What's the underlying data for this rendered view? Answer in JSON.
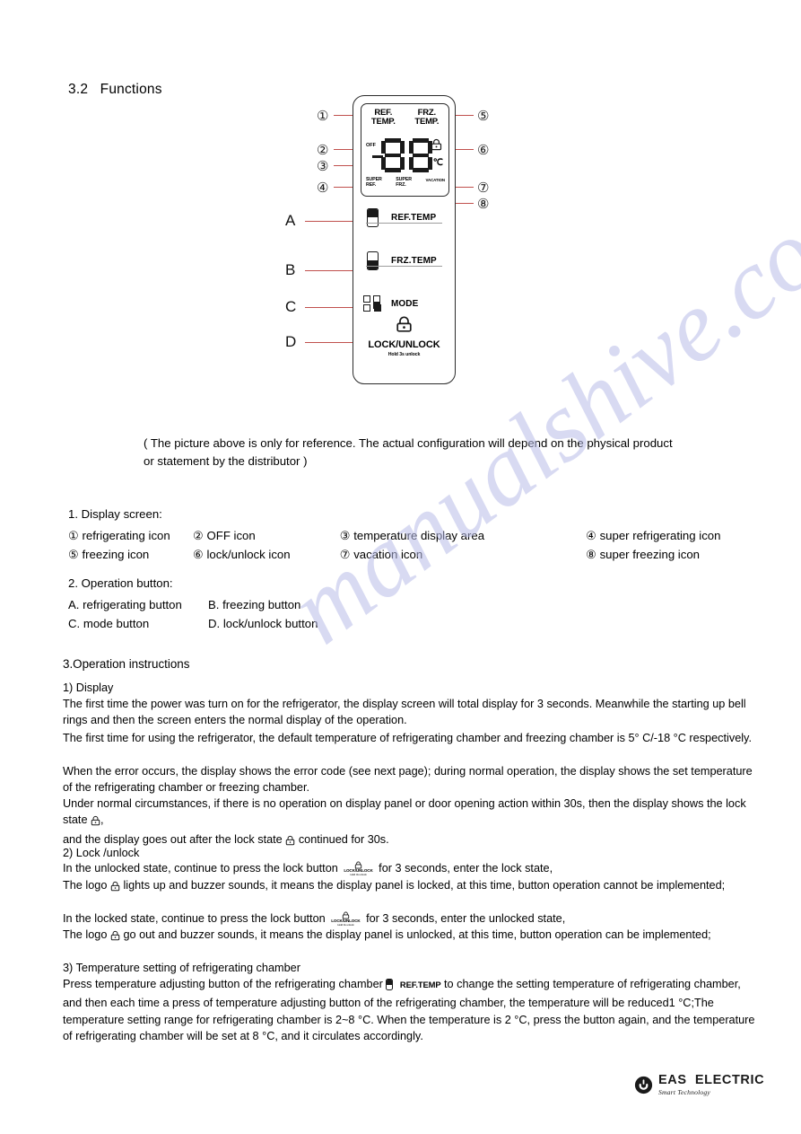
{
  "heading": "3.2   Functions",
  "panel": {
    "lcd": {
      "ref_temp_label": "REF.\nTEMP.",
      "frz_temp_label": "FRZ.\nTEMP.",
      "off_label": "OFF",
      "digits": "88",
      "unit_label": "℃",
      "super_ref_label": "SUPER\nREF.",
      "super_frz_label": "SUPER\nFRZ.",
      "vacation_label": "VACATION"
    },
    "buttons": [
      {
        "label": "REF.TEMP",
        "icon": "switch-top-dark-icon"
      },
      {
        "label": "FRZ.TEMP",
        "icon": "switch-bottom-dark-icon"
      },
      {
        "label": "MODE",
        "icon": "mode-grid-icon"
      }
    ],
    "lock": {
      "title": "LOCK/UNLOCK",
      "subtitle": "Hold 3s unlock",
      "icon": "padlock-icon"
    }
  },
  "callouts": {
    "left_numbers": [
      "①",
      "②",
      "③",
      "④"
    ],
    "right_numbers": [
      "⑤",
      "⑥",
      "⑦",
      "⑧"
    ],
    "letters": [
      "A",
      "B",
      "C",
      "D"
    ]
  },
  "reference_note": "( The picture above is only for reference. The actual configuration will depend on the physical product or statement by the distributor )",
  "display_screen": {
    "heading": "1. Display screen:",
    "items": [
      "① refrigerating icon",
      "② OFF icon",
      "③ temperature display area",
      "④ super refrigerating icon",
      "⑤ freezing icon",
      "⑥ lock/unlock icon",
      "⑦ vacation icon",
      "⑧ super freezing icon"
    ]
  },
  "operation_button": {
    "heading": "2. Operation button:",
    "items": [
      "A. refrigerating button",
      "B. freezing button",
      "C. mode button",
      "D. lock/unlock button"
    ]
  },
  "instructions": {
    "heading": "3.Operation instructions",
    "display_heading": "1) Display",
    "p1": "The first time the power was turn on for the refrigerator, the display screen will total display  for  3 seconds. Meanwhile the starting up bell rings and then the screen enters the normal display of the operation.",
    "p2": "The first time for using the refrigerator, the default temperature of refrigerating chamber and freezing chamber is 5° C/-18 °C respectively.",
    "p3": "When the error occurs, the display shows the error code (see next page); during normal operation, the display shows the set temperature of the  refrigerating chamber or freezing chamber.",
    "p4_a": "Under normal circumstances, if there is no operation on display panel or door opening action within 30s, then the display shows the lock state",
    "p4_b": ",",
    "p4_c": "and the display goes out after the lock state",
    "p4_d": "continued for 30s.",
    "lock_heading": "2) Lock /unlock",
    "p5_a": "In the unlocked state, continue to press the lock button",
    "p5_b": "for 3 seconds, enter the lock state,",
    "p6_a": "The logo",
    "p6_b": "lights up  and buzzer sounds, it means the display panel is locked, at this time, button operation cannot be implemented;",
    "p7_a": "In the locked state, continue to press the lock button",
    "p7_b": "for 3 seconds, enter the unlocked state,",
    "p8_a": "The logo",
    "p8_b": "go out and buzzer sounds, it means the display panel is unlocked, at this time, button operation can be implemented;",
    "temp_heading": "3) Temperature setting of refrigerating chamber",
    "p9_a": "Press temperature adjusting button of the refrigerating chamber",
    "p9_btn_label": "REF.TEMP",
    "p9_b": "to change the setting temperature of refrigerating chamber, and then each time a press of temperature adjusting button of the refrigerating chamber, the temperature will be reduced1 °C;The temperature setting range for refrigerating chamber is 2~8 °C. When the temperature is 2 °C, press the button again, and the temperature of refrigerating chamber will be set at 8 °C, and it circulates accordingly.",
    "inline_lock_button": {
      "title": "LOCK/UNLOCK",
      "subtitle": "Hold 3s unlock"
    }
  },
  "watermark": "manualshive.com",
  "footer": {
    "brand": "EAS  ELECTRIC",
    "tagline": "Smart Technology"
  },
  "colors": {
    "leader_line": "#c0504d",
    "ink": "#1a1a1a",
    "watermark": "#b9bde8"
  }
}
